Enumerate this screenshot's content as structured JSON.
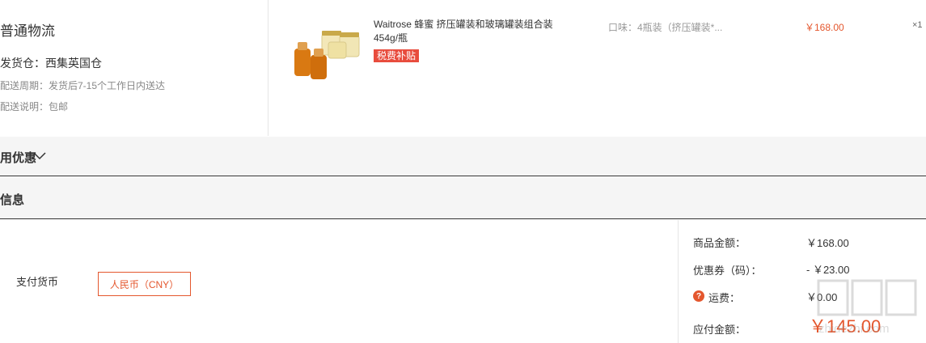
{
  "shipping": {
    "method": "普通物流",
    "warehouse": "发货仓：西集英国仓",
    "period": "配送周期：发货后7-15个工作日内送达",
    "note": "配送说明：包邮"
  },
  "product": {
    "name": "Waitrose 蜂蜜 挤压罐装和玻璃罐装组合装 454g/瓶",
    "badge": "税费补贴",
    "flavor": "口味：4瓶装（挤压罐装*...",
    "price": "￥168.00",
    "quantity": "×1"
  },
  "sections": {
    "discount": "用优惠",
    "info": "信息"
  },
  "payment": {
    "label": "支付货币",
    "currency": "人民币（CNY）"
  },
  "summary": {
    "goods_label": "商品金额：",
    "goods_value": "￥168.00",
    "coupon_label": "优惠券（码）：",
    "coupon_value": "- ￥23.00",
    "help_symbol": "?",
    "shipping_label": "运费：",
    "shipping_value": "￥0.00",
    "total_label": "应付金额：",
    "total_value": "￥145.00"
  },
  "watermark": {
    "text": "zhidezhi.com"
  },
  "colors": {
    "accent": "#e4572e",
    "badge": "#e84c3d",
    "bar_bg": "#f5f5f5"
  }
}
